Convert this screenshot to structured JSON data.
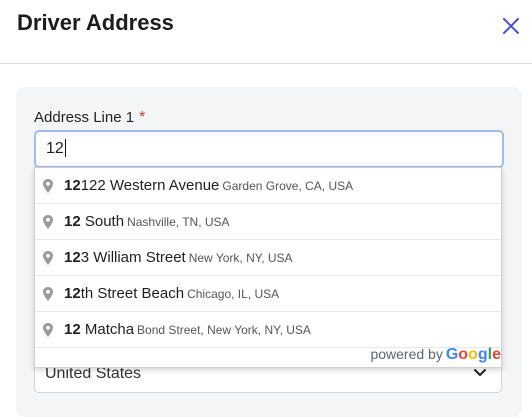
{
  "header": {
    "title": "Driver Address",
    "close_icon": "close-icon"
  },
  "form": {
    "address_line_1": {
      "label": "Address Line 1",
      "required_mark": "*",
      "value": "12"
    },
    "country": {
      "value": "United States"
    }
  },
  "autocomplete": {
    "suggestions": [
      {
        "match": "12",
        "rest": "122 Western Avenue",
        "secondary": "Garden Grove, CA, USA"
      },
      {
        "match": "12",
        "rest": " South",
        "secondary": "Nashville, TN, USA"
      },
      {
        "match": "12",
        "rest": "3 William Street",
        "secondary": "New York, NY, USA"
      },
      {
        "match": "12",
        "rest": "th Street Beach",
        "secondary": "Chicago, IL, USA"
      },
      {
        "match": "12",
        "rest": " Matcha",
        "secondary": "Bond Street, New York, NY, USA"
      }
    ],
    "powered_by": "powered by",
    "provider": "Google"
  },
  "colors": {
    "accent": "#4a4fd8",
    "required": "#d9382e",
    "focus_border": "#9dbcf0",
    "card_bg": "#f4f5f7"
  },
  "icons": {
    "suggestion": "map-pin-icon",
    "select": "chevron-down-icon"
  }
}
